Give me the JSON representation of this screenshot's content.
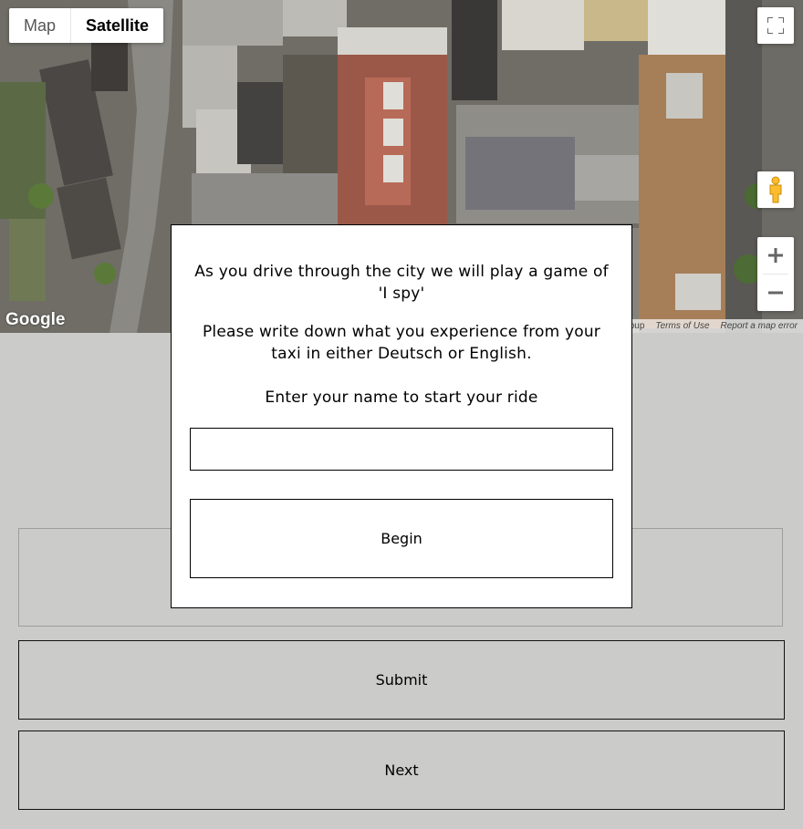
{
  "map": {
    "type_options": [
      "Map",
      "Satellite"
    ],
    "selected_type": "Satellite",
    "logo_text": "Google",
    "attribution": {
      "data_text": "roup",
      "terms_text": "Terms of Use",
      "report_text": "Report a map error"
    },
    "icons": {
      "fullscreen": "fullscreen-icon",
      "pegman": "pegman-icon",
      "zoom_in": "plus-icon",
      "zoom_out": "minus-icon"
    }
  },
  "modal": {
    "intro_text": "As you drive through the city we will play a game of 'I spy'",
    "instructions_text": "Please write down what you experience from your taxi in either Deutsch or English.",
    "name_prompt": "Enter your name to start your ride",
    "name_value": "",
    "begin_label": "Begin"
  },
  "page": {
    "text_value": "",
    "submit_label": "Submit",
    "next_label": "Next"
  }
}
